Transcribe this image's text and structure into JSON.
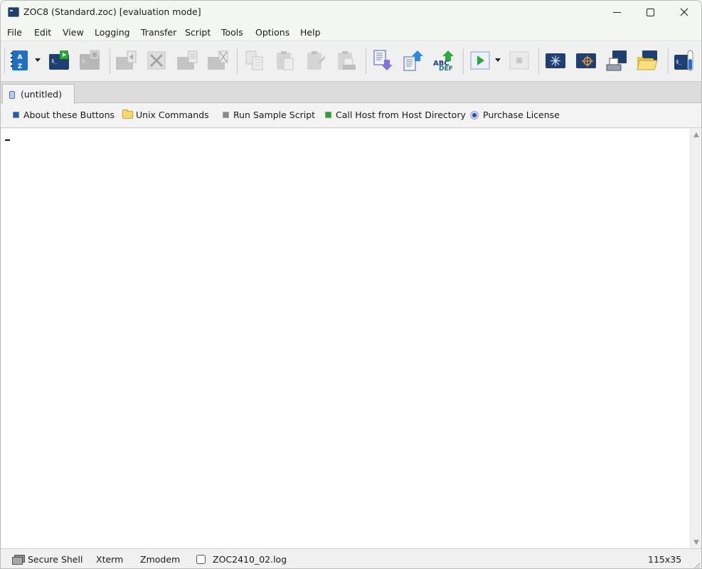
{
  "window": {
    "title": "ZOC8 (Standard.zoc) [evaluation mode]",
    "controls": {
      "minimize": "minimize",
      "maximize": "maximize",
      "close": "close"
    }
  },
  "menu": {
    "items": [
      "File",
      "Edit",
      "View",
      "Logging",
      "Transfer",
      "Script",
      "Tools",
      "Options",
      "Help"
    ]
  },
  "toolbar": {
    "buttons": [
      {
        "name": "host-directory",
        "icon": "address-book-az-icon",
        "enabled": true,
        "has_dropdown": true
      },
      {
        "name": "quick-connect",
        "icon": "terminal-play-icon",
        "enabled": true
      },
      {
        "name": "new-session",
        "icon": "terminal-stop-icon",
        "enabled": false
      },
      {
        "name": "send-break",
        "icon": "session-back-icon",
        "enabled": false
      },
      {
        "name": "disconnect",
        "icon": "session-x-icon",
        "enabled": false
      },
      {
        "name": "duplicate-session",
        "icon": "session-copy-icon",
        "enabled": false
      },
      {
        "name": "close-session",
        "icon": "session-close-icon",
        "enabled": false
      },
      {
        "name": "copy",
        "icon": "copy-icon",
        "enabled": false
      },
      {
        "name": "paste",
        "icon": "paste-icon",
        "enabled": false
      },
      {
        "name": "paste-special",
        "icon": "paste-edit-icon",
        "enabled": false
      },
      {
        "name": "print-clipboard",
        "icon": "paste-print-icon",
        "enabled": false
      },
      {
        "name": "download",
        "icon": "download-icon",
        "enabled": true
      },
      {
        "name": "upload",
        "icon": "upload-icon",
        "enabled": true
      },
      {
        "name": "translate",
        "icon": "abc-def-icon",
        "enabled": true,
        "label": "ABC DEF"
      },
      {
        "name": "run-script",
        "icon": "play-script-icon",
        "enabled": true,
        "has_dropdown": true
      },
      {
        "name": "stop-script",
        "icon": "stop-icon",
        "enabled": false
      },
      {
        "name": "sparkle",
        "icon": "sparkle-icon",
        "enabled": true
      },
      {
        "name": "target",
        "icon": "crosshair-icon",
        "enabled": true
      },
      {
        "name": "print-screen",
        "icon": "printer-icon",
        "enabled": true
      },
      {
        "name": "open-folder",
        "icon": "folder-icon",
        "enabled": true
      },
      {
        "name": "terminal-level",
        "icon": "terminal-thermometer-icon",
        "enabled": true
      }
    ]
  },
  "tabs": [
    {
      "label": "(untitled)",
      "active": true
    }
  ],
  "userbar": {
    "items": [
      {
        "label": "About these Buttons",
        "icon": "blue-square-icon"
      },
      {
        "label": "Unix Commands",
        "icon": "folder-icon"
      },
      {
        "label": "Run Sample Script",
        "icon": "gray-square-icon"
      },
      {
        "label": "Call Host from Host Directory",
        "icon": "green-square-icon"
      },
      {
        "label": "Purchase License",
        "icon": "radio-icon"
      }
    ]
  },
  "terminal": {
    "content": ""
  },
  "statusbar": {
    "connection": "Secure Shell",
    "emulation": "Xterm",
    "transfer": "Zmodem",
    "logfile": "ZOC2410_02.log",
    "logging_enabled": false,
    "size": "115x35"
  },
  "colors": {
    "accent_blue": "#1f3f66",
    "arrow_blue": "#2f86e0",
    "arrow_purple": "#7f74e0",
    "arrow_green": "#2eaa3c",
    "folder_yellow": "#f7d77a"
  }
}
